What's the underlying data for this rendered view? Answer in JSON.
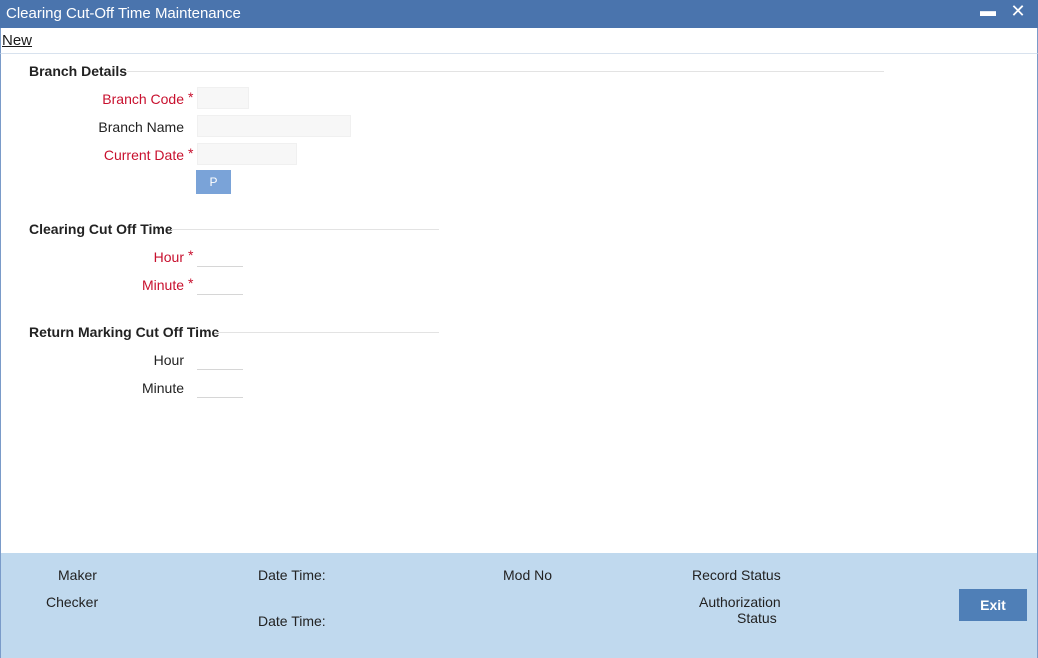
{
  "window": {
    "title": "Clearing Cut-Off Time Maintenance",
    "minimize_label": "▬",
    "close_label": "✕"
  },
  "toolbar": {
    "new_label": "New"
  },
  "branch_details": {
    "title": "Branch Details",
    "branch_code_label": "Branch Code",
    "branch_name_label": "Branch Name",
    "current_date_label": "Current Date",
    "branch_code_value": "",
    "branch_name_value": "",
    "current_date_value": "",
    "p_button_label": "P"
  },
  "clearing_cut_off": {
    "title": "Clearing Cut Off Time",
    "hour_label": "Hour",
    "minute_label": "Minute",
    "hour_value": "",
    "minute_value": ""
  },
  "return_marking_cut_off": {
    "title": "Return Marking Cut Off Time",
    "hour_label": "Hour",
    "minute_label": "Minute",
    "hour_value": "",
    "minute_value": ""
  },
  "required_marker": "*",
  "footer": {
    "maker_label": "Maker",
    "checker_label": "Checker",
    "date_time_label_1": "Date Time:",
    "date_time_label_2": "Date Time:",
    "mod_no_label": "Mod No",
    "record_status_label": "Record Status",
    "authorization_label": "Authorization",
    "status_label": "Status",
    "exit_label": "Exit"
  },
  "colors": {
    "titlebar": "#4a74ad",
    "required": "#c8102e",
    "footer": "#c0d9ee",
    "exit_button": "#4f7fb7",
    "p_button": "#7aa3d8"
  }
}
